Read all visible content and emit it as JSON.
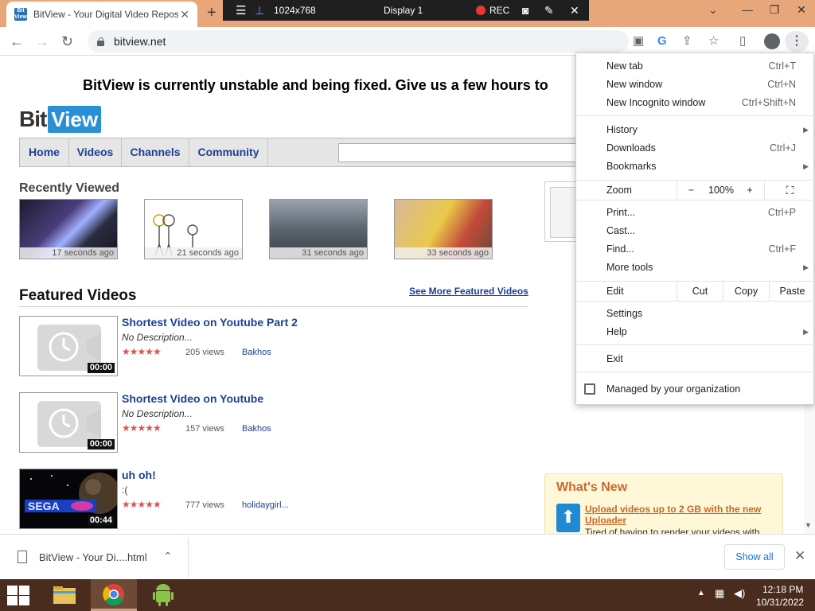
{
  "browser": {
    "tab_title": "BitView - Your Digital Video Repository",
    "favicon_text": "Bit View",
    "tab_close": "✕",
    "new_tab": "+",
    "url": "bitview.net",
    "tab_dropdown": "⌄"
  },
  "recorder_toolbar": {
    "resolution": "1024x768",
    "display": "Display 1",
    "rec_label": "REC"
  },
  "window_controls": {
    "minimize": "—",
    "restore": "❐",
    "close": "✕"
  },
  "toolbar_icons": [
    "reading-list-icon",
    "google-lens-icon",
    "share-icon",
    "bookmark-star-icon",
    "side-panel-icon",
    "profile-icon",
    "menu-icon"
  ],
  "page": {
    "banner": "BitView is currently unstable and being fixed. Give us a few hours to",
    "logo_bit": "Bit",
    "logo_view": "View",
    "nav": [
      "Home",
      "Videos",
      "Channels",
      "Community"
    ],
    "recently_viewed_heading": "Recently Viewed",
    "recently_viewed": [
      {
        "time": "17 seconds ago"
      },
      {
        "time": "21 seconds ago"
      },
      {
        "time": "31 seconds ago"
      },
      {
        "time": "33 seconds ago"
      }
    ],
    "featured_heading": "Featured Videos",
    "see_more": "See More Featured Videos",
    "featured": [
      {
        "title": "Shortest Video on Youtube Part 2",
        "description": "No Description...",
        "stars": "★★★★★",
        "views": "205 views",
        "user": "Bakhos",
        "duration": "00:00"
      },
      {
        "title": "Shortest Video on Youtube",
        "description": "No Description...",
        "stars": "★★★★★",
        "views": "157 views",
        "user": "Bakhos",
        "duration": "00:00"
      },
      {
        "title": "uh oh!",
        "description": ":(",
        "stars": "★★★★★",
        "views": "777 views",
        "user": "holidaygirl...",
        "duration": "00:44"
      }
    ],
    "whats_new": {
      "title": "What's New",
      "link": "Upload videos up to 2 GB with the new Uploader",
      "text": "Tired of having to render your videos with"
    }
  },
  "chrome_menu": {
    "new_tab": {
      "label": "New tab",
      "shortcut": "Ctrl+T"
    },
    "new_window": {
      "label": "New window",
      "shortcut": "Ctrl+N"
    },
    "incognito": {
      "label": "New Incognito window",
      "shortcut": "Ctrl+Shift+N"
    },
    "history": {
      "label": "History"
    },
    "downloads": {
      "label": "Downloads",
      "shortcut": "Ctrl+J"
    },
    "bookmarks": {
      "label": "Bookmarks"
    },
    "zoom": {
      "label": "Zoom",
      "minus": "−",
      "value": "100%",
      "plus": "+"
    },
    "print": {
      "label": "Print...",
      "shortcut": "Ctrl+P"
    },
    "cast": {
      "label": "Cast..."
    },
    "find": {
      "label": "Find...",
      "shortcut": "Ctrl+F"
    },
    "more_tools": {
      "label": "More tools"
    },
    "edit": {
      "label": "Edit",
      "cut": "Cut",
      "copy": "Copy",
      "paste": "Paste"
    },
    "settings": {
      "label": "Settings"
    },
    "help": {
      "label": "Help"
    },
    "exit": {
      "label": "Exit"
    },
    "managed": {
      "label": "Managed by your organization"
    },
    "submenu_arrow": "▶"
  },
  "download_bar": {
    "file_name": "BitView - Your Di....html",
    "show_all": "Show all",
    "close": "✕",
    "chevron": "⌃"
  },
  "taskbar": {
    "time": "12:18 PM",
    "date": "10/31/2022",
    "apps": [
      "file-explorer-icon",
      "chrome-icon",
      "android-icon"
    ],
    "accent": "#4a2c1e"
  },
  "colors": {
    "tab_strip": "#e8a77a",
    "link_blue": "#1c3f94",
    "star_red": "#d9534f",
    "whats_new_orange": "#c7682a"
  }
}
